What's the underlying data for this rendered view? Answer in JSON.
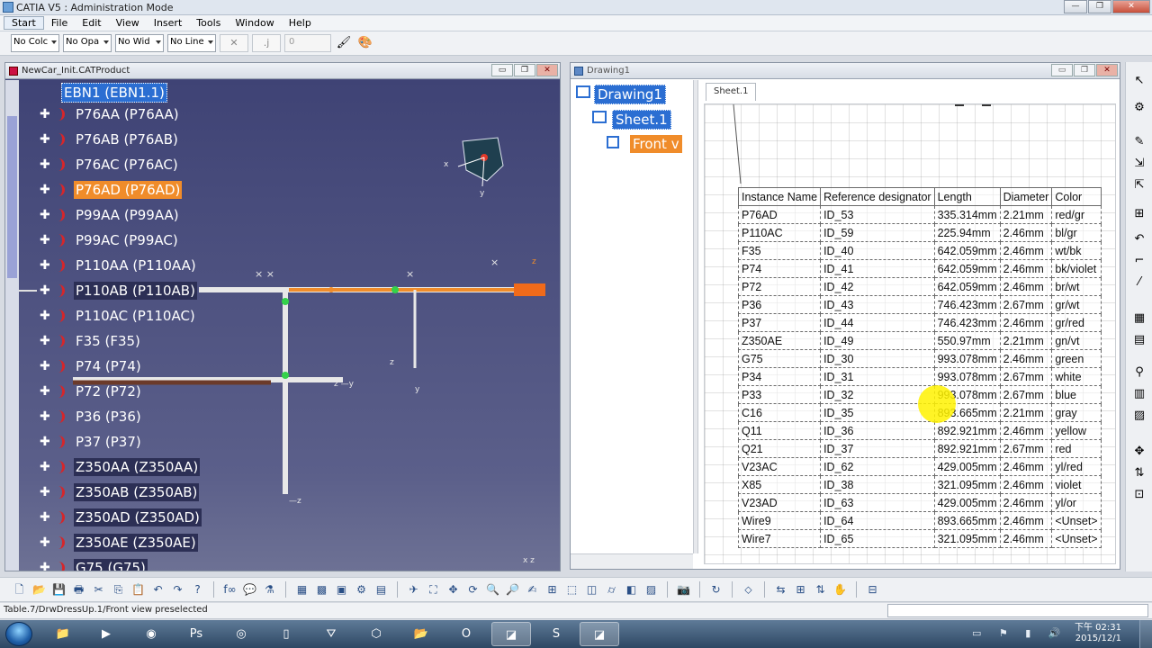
{
  "app": {
    "title": "CATIA V5 : Administration Mode",
    "window_buttons": [
      "—",
      "❐",
      "✕"
    ]
  },
  "menu": [
    "Start",
    "File",
    "Edit",
    "View",
    "Insert",
    "Tools",
    "Window",
    "Help"
  ],
  "toolbar": {
    "color_select": "No Colc",
    "opacity_select": "No Opa",
    "width_select": "No Wid",
    "line_select": "No Line",
    "point_value": "✕",
    "layer_value": ".j",
    "number_value": "0"
  },
  "product_window": {
    "title": "NewCar_Init.CATProduct",
    "root": "EBN1 (EBN1.1)",
    "items": [
      {
        "label": "P76AA (P76AA)",
        "style": "plain"
      },
      {
        "label": "P76AB (P76AB)",
        "style": "plain"
      },
      {
        "label": "P76AC (P76AC)",
        "style": "plain"
      },
      {
        "label": "P76AD (P76AD)",
        "style": "selected"
      },
      {
        "label": "P99AA (P99AA)",
        "style": "plain"
      },
      {
        "label": "P99AC (P99AC)",
        "style": "plain"
      },
      {
        "label": "P110AA (P110AA)",
        "style": "plain"
      },
      {
        "label": "P110AB (P110AB)",
        "style": "dark"
      },
      {
        "label": "P110AC (P110AC)",
        "style": "plain"
      },
      {
        "label": "F35 (F35)",
        "style": "plain"
      },
      {
        "label": "P74 (P74)",
        "style": "plain"
      },
      {
        "label": "P72 (P72)",
        "style": "plain"
      },
      {
        "label": "P36 (P36)",
        "style": "plain"
      },
      {
        "label": "P37 (P37)",
        "style": "plain"
      },
      {
        "label": "Z350AA (Z350AA)",
        "style": "dark"
      },
      {
        "label": "Z350AB (Z350AB)",
        "style": "dark"
      },
      {
        "label": "Z350AD (Z350AD)",
        "style": "dark"
      },
      {
        "label": "Z350AE (Z350AE)",
        "style": "dark"
      },
      {
        "label": "G75 (G75)",
        "style": "dark"
      }
    ]
  },
  "drawing_window": {
    "title": "Drawing1",
    "tree": {
      "drawing": "Drawing1",
      "sheet": "Sheet.1",
      "view": "Front v"
    },
    "tab": "Sheet.1",
    "table": {
      "headers": [
        "Instance Name",
        "Reference designator",
        "Length",
        "Diameter",
        "Color"
      ],
      "rows": [
        [
          "P76AD",
          "ID_53",
          "335.314mm",
          "2.21mm",
          "red/gr"
        ],
        [
          "P110AC",
          "ID_59",
          "225.94mm",
          "2.46mm",
          "bl/gr"
        ],
        [
          "F35",
          "ID_40",
          "642.059mm",
          "2.46mm",
          "wt/bk"
        ],
        [
          "P74",
          "ID_41",
          "642.059mm",
          "2.46mm",
          "bk/violet"
        ],
        [
          "P72",
          "ID_42",
          "642.059mm",
          "2.46mm",
          "br/wt"
        ],
        [
          "P36",
          "ID_43",
          "746.423mm",
          "2.67mm",
          "gr/wt"
        ],
        [
          "P37",
          "ID_44",
          "746.423mm",
          "2.46mm",
          "gr/red"
        ],
        [
          "Z350AE",
          "ID_49",
          "550.97mm",
          "2.21mm",
          "gn/vt"
        ],
        [
          "G75",
          "ID_30",
          "993.078mm",
          "2.46mm",
          "green"
        ],
        [
          "P34",
          "ID_31",
          "993.078mm",
          "2.67mm",
          "white"
        ],
        [
          "P33",
          "ID_32",
          "993.078mm",
          "2.67mm",
          "blue"
        ],
        [
          "C16",
          "ID_35",
          "893.665mm",
          "2.21mm",
          "gray"
        ],
        [
          "Q11",
          "ID_36",
          "892.921mm",
          "2.46mm",
          "yellow"
        ],
        [
          "Q21",
          "ID_37",
          "892.921mm",
          "2.67mm",
          "red"
        ],
        [
          "V23AC",
          "ID_62",
          "429.005mm",
          "2.46mm",
          "yl/red"
        ],
        [
          "X85",
          "ID_38",
          "321.095mm",
          "2.46mm",
          "violet"
        ],
        [
          "V23AD",
          "ID_63",
          "429.005mm",
          "2.46mm",
          "yl/or"
        ],
        [
          "Wire9",
          "ID_64",
          "893.665mm",
          "2.46mm",
          "<Unset>"
        ],
        [
          "Wire7",
          "ID_65",
          "321.095mm",
          "2.46mm",
          "<Unset>"
        ]
      ]
    }
  },
  "status": {
    "text": "Table.7/DrwDressUp.1/Front view preselected"
  },
  "taskbar": {
    "time": "下午 02:31",
    "date": "2015/12/1"
  },
  "colors": {
    "selected_orange": "#f08c2a",
    "selected_blue": "#2b6ed2",
    "canvas": "#484c7c"
  }
}
